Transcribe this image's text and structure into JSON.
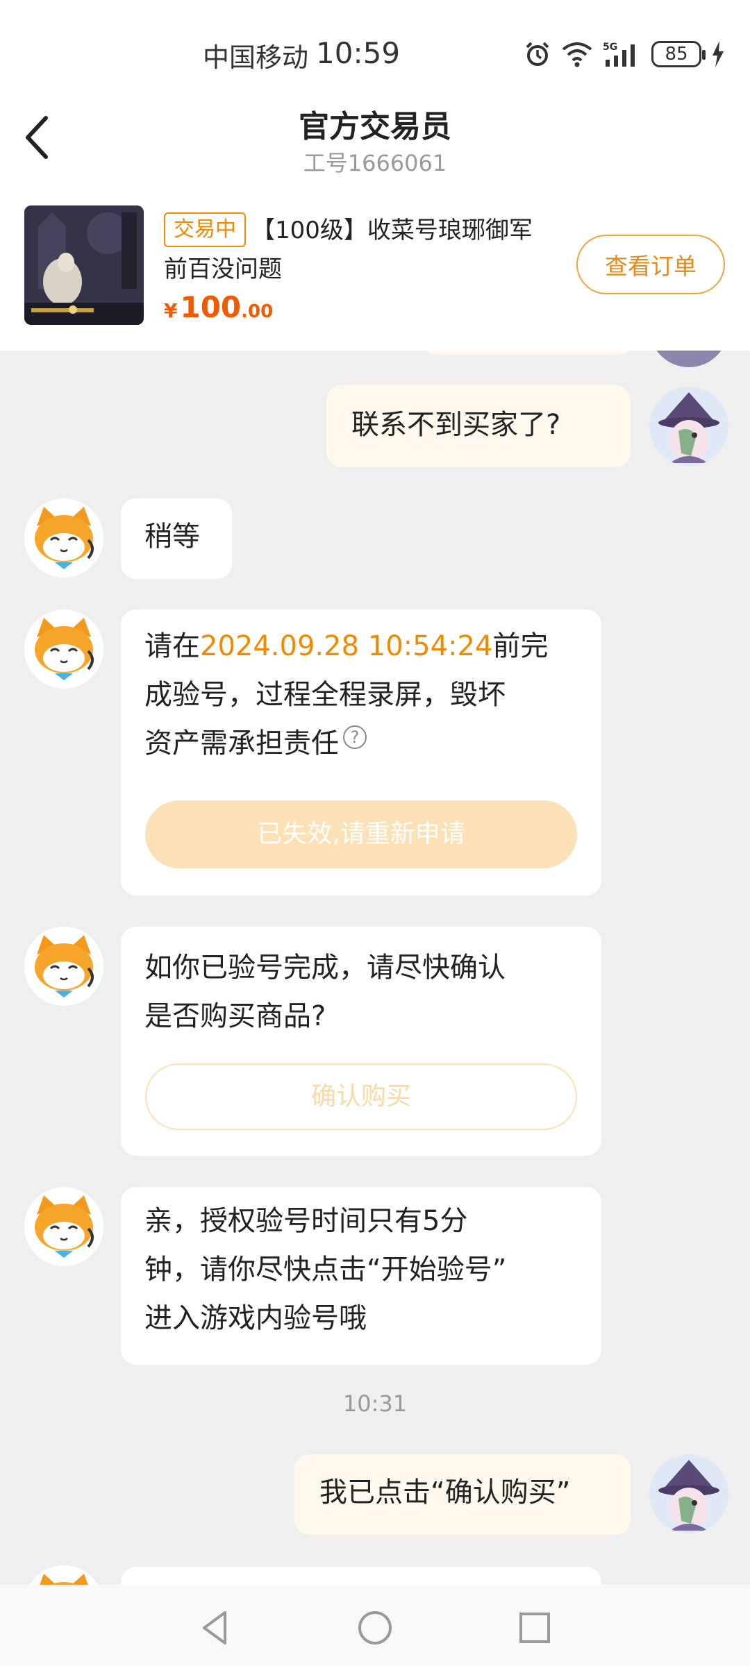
{
  "status_bar": {
    "carrier": "中国移动",
    "time": "10:59",
    "battery": "85",
    "network": "5G"
  },
  "header": {
    "title": "官方交易员",
    "subtitle": "工号1666061"
  },
  "order": {
    "status_tag": "交易中",
    "title_line1": "【100级】收菜号琅琊御军",
    "title_line2": "前百没问题",
    "price_currency": "¥",
    "price_int": "100",
    "price_dec": ".00",
    "view_order_label": "查看订单"
  },
  "messages": {
    "m1": {
      "text": "联系不到买家了?"
    },
    "m2": {
      "text": "稍等"
    },
    "m3": {
      "line1_pre": "请在",
      "line1_deadline": "2024.09.28 10:54:24",
      "line1_post": "前完",
      "line2": "成验号，过程全程录屏，毁坏",
      "line3": "资产需承担责任",
      "help_icon": "?",
      "button": "已失效,请重新申请"
    },
    "m4": {
      "line1": "如你已验号完成，请尽快确认",
      "line2": "是否购买商品?",
      "button": "确认购买"
    },
    "m5": {
      "line1": "亲，授权验号时间只有5分",
      "line2": "钟，请你尽快点击“开始验号”",
      "line3": "进入游戏内验号哦"
    },
    "timestamp": "10:31",
    "m6": {
      "text": "我已点击“确认购买”"
    }
  },
  "colors": {
    "accent": "#f28a00",
    "price": "#f05a00",
    "my_bubble": "#fff8ec",
    "background": "#efefef"
  }
}
